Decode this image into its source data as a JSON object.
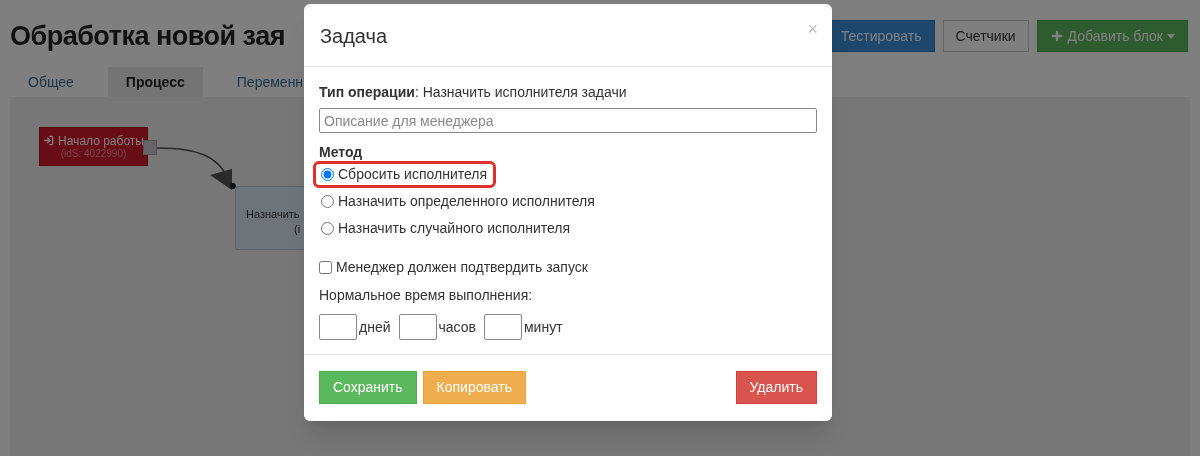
{
  "page": {
    "title": "Обработка новой зая",
    "buttons": [
      {
        "label": "Тестировать",
        "kind": "primary"
      },
      {
        "label": "Счетчики",
        "kind": "default"
      },
      {
        "label": "Добавить блок",
        "kind": "success"
      }
    ]
  },
  "tabs": [
    {
      "label": "Общее",
      "selected": false
    },
    {
      "label": "Процесс",
      "selected": true
    },
    {
      "label": "Переменн",
      "selected": false
    }
  ],
  "canvas": {
    "nodes": [
      {
        "kind": "start",
        "label": "Начало работы",
        "id_text": "(idS: 4022990)"
      },
      {
        "kind": "task",
        "label": "Назначить",
        "id_text": "(i"
      }
    ]
  },
  "dialog": {
    "title": "Задача",
    "close": "×",
    "operation": "**Тип операции**: Назначить исполнителя задачи",
    "description": {
      "placeholder": "Описание для менеджера"
    },
    "method": {
      "label": "Метод",
      "options": [
        {
          "label": "Сбросить исполнителя",
          "selected": true,
          "highlighted": true
        },
        {
          "label": "Назначить определенного исполнителя",
          "selected": false,
          "highlighted": false
        },
        {
          "label": "Назначить случайного исполнителя",
          "selected": false,
          "highlighted": false
        }
      ]
    },
    "confirm": {
      "label": "Менеджер должен подтвердить запуск",
      "checked": false
    },
    "duration": {
      "label": "Нормальное время выполнения:",
      "fields": [
        {
          "unit": "дней"
        },
        {
          "unit": "часов"
        },
        {
          "unit": "минут"
        }
      ]
    },
    "buttons": [
      {
        "label": "Сохранить",
        "kind": "success"
      },
      {
        "label": "Копировать",
        "kind": "warning"
      },
      {
        "label": "Удалить",
        "kind": "danger"
      }
    ]
  }
}
